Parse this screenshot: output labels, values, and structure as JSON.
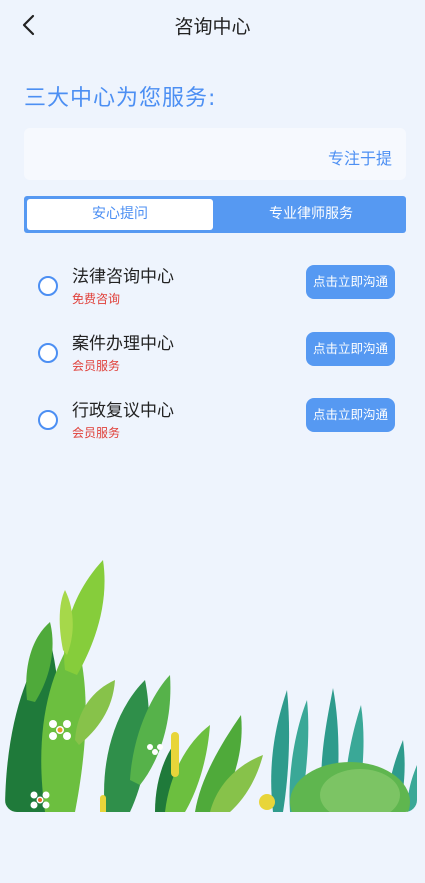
{
  "header": {
    "title": "咨询中心",
    "back_icon": "chevron-left-icon"
  },
  "heading": "三大中心为您服务:",
  "marquee": {
    "text": "专注于提"
  },
  "tabs": [
    {
      "label": "安心提问",
      "active": true
    },
    {
      "label": "专业律师服务",
      "active": false
    }
  ],
  "services": [
    {
      "name": "法律咨询中心",
      "subtitle": "免费咨询",
      "button": "点击立即沟通"
    },
    {
      "name": "案件办理中心",
      "subtitle": "会员服务",
      "button": "点击立即沟通"
    },
    {
      "name": "行政复议中心",
      "subtitle": "会员服务",
      "button": "点击立即沟通"
    }
  ],
  "colors": {
    "accent": "#4c8ff3",
    "button": "#5699f2",
    "subtitle_red": "#e0403a",
    "background": "#eef4fd"
  }
}
